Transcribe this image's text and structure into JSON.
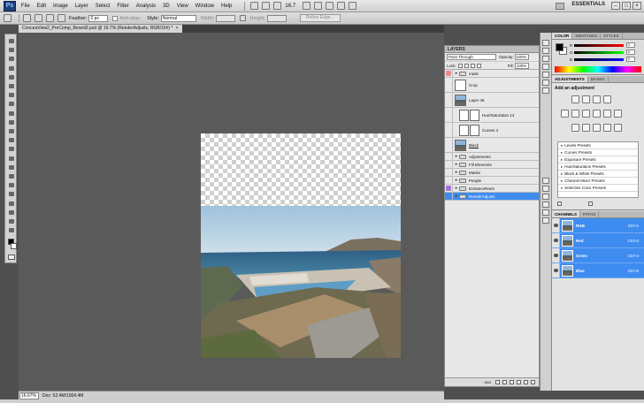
{
  "app": {
    "logo": "Ps"
  },
  "menu": [
    "File",
    "Edit",
    "Image",
    "Layer",
    "Select",
    "Filter",
    "Analysis",
    "3D",
    "View",
    "Window",
    "Help"
  ],
  "zoom_level": "16.7",
  "workspace": "ESSENTIALS",
  "window_controls": [
    "–",
    "□",
    "×"
  ],
  "options": {
    "feather_label": "Feather:",
    "feather_value": "0 px",
    "antialias_label": "Anti-alias",
    "style_label": "Style:",
    "style_value": "Normal",
    "width_label": "Width:",
    "height_label": "Height:",
    "refine_edge": "Refine Edge..."
  },
  "document": {
    "tab_title": "ConceaView2_PreComp_Rewrd2.psd @ 16.7% (RenderAdjusts, RGB/16#) *",
    "close": "×"
  },
  "status": {
    "zoom": "16.67%",
    "doc_info": "Doc: 62.4M/1004.4M"
  },
  "layers_panel": {
    "tab": "LAYERS",
    "blend_mode": "Pass Through",
    "opacity_label": "Opacity:",
    "opacity_value": "100%",
    "lock_label": "Lock:",
    "fill_label": "Fill:",
    "fill_value": "100%",
    "layers": [
      {
        "name": "mask",
        "kind": "group",
        "color": "#e88a8a",
        "visible": true
      },
      {
        "name": "Crop",
        "kind": "layer",
        "visible": false
      },
      {
        "name": "Layer 46",
        "kind": "photo",
        "visible": false
      },
      {
        "name": "Hue/Saturation 14",
        "kind": "adjustment",
        "visible": false
      },
      {
        "name": "Curves 4",
        "kind": "adjustment",
        "visible": false
      },
      {
        "name": "Black",
        "kind": "photo",
        "visible": false
      },
      {
        "name": "Adjustments",
        "kind": "group",
        "color": "#f0a37a",
        "visible": false
      },
      {
        "name": "Fill Elements",
        "kind": "group",
        "color": "#f2d86a",
        "visible": false
      },
      {
        "name": "Masks",
        "kind": "group",
        "color": "#9ad27a",
        "visible": false
      },
      {
        "name": "People",
        "kind": "group",
        "color": "#b79be0",
        "visible": false
      },
      {
        "name": "EntranceRamt",
        "kind": "group",
        "color": "#a374d8",
        "visible": true
      },
      {
        "name": "RenderAdjusts",
        "kind": "group",
        "color": "#3f8cf0",
        "visible": true,
        "selected": true
      }
    ],
    "footer_label": "ooo"
  },
  "color_panel": {
    "tabs": [
      "COLOR",
      "SWATCHES",
      "STYLES"
    ],
    "channels": [
      {
        "label": "R",
        "value": "0"
      },
      {
        "label": "G",
        "value": "0"
      },
      {
        "label": "B",
        "value": "0"
      }
    ]
  },
  "adjustments_panel": {
    "tabs": [
      "ADJUSTMENTS",
      "MASKS"
    ],
    "title": "Add an adjustment",
    "presets": [
      "Levels Presets",
      "Curves Presets",
      "Exposure Presets",
      "Hue/Saturation Presets",
      "Black & White Presets",
      "Channel Mixer Presets",
      "Selective Color Presets"
    ]
  },
  "channels_panel": {
    "tabs": [
      "CHANNELS",
      "PATHS"
    ],
    "channels": [
      {
        "name": "RGB",
        "shortcut": "Ctrl+2"
      },
      {
        "name": "Red",
        "shortcut": "Ctrl+3"
      },
      {
        "name": "Green",
        "shortcut": "Ctrl+4"
      },
      {
        "name": "Blue",
        "shortcut": "Ctrl+5"
      }
    ]
  }
}
